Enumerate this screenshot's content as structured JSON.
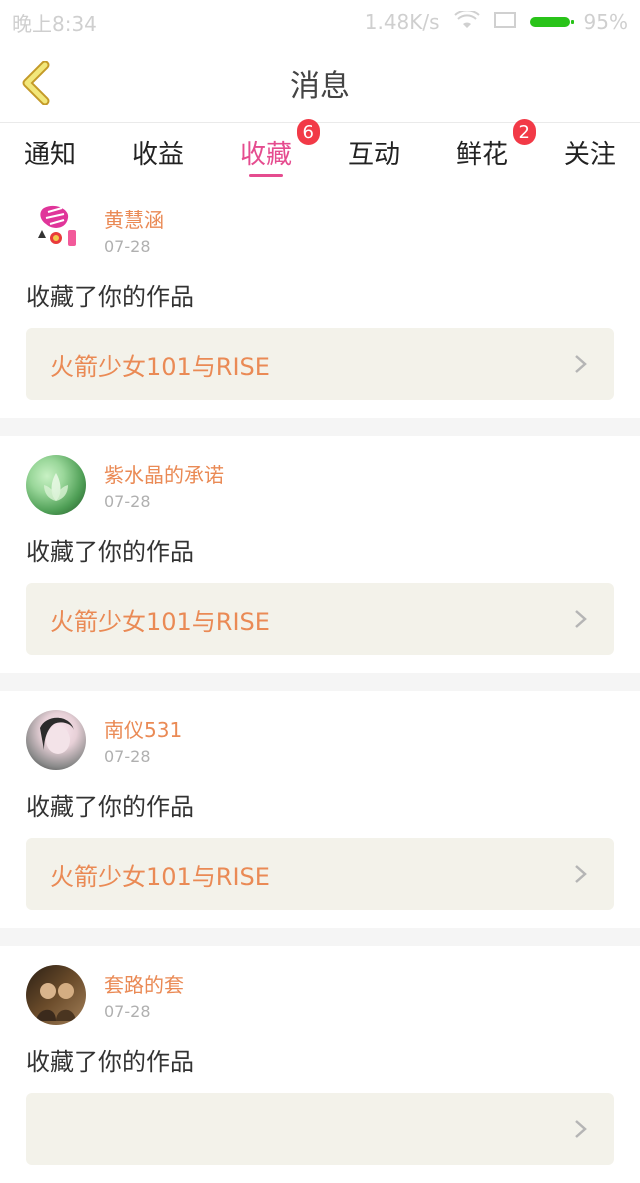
{
  "status": {
    "left": "晚上8:34",
    "speed": "1.48K/s",
    "battery_percent": "95%"
  },
  "header": {
    "title": "消息"
  },
  "tabs": [
    {
      "label": "通知",
      "badge": null
    },
    {
      "label": "收益",
      "badge": null
    },
    {
      "label": "收藏",
      "badge": "6",
      "active": true
    },
    {
      "label": "互动",
      "badge": null
    },
    {
      "label": "鲜花",
      "badge": "2"
    },
    {
      "label": "关注",
      "badge": null
    }
  ],
  "cards": [
    {
      "name": "黄慧涵",
      "date": "07-28",
      "action": "收藏了你的作品",
      "work_title": "火箭少女101与RISE"
    },
    {
      "name": "紫水晶的承诺",
      "date": "07-28",
      "action": "收藏了你的作品",
      "work_title": "火箭少女101与RISE"
    },
    {
      "name": "南仪531",
      "date": "07-28",
      "action": "收藏了你的作品",
      "work_title": "火箭少女101与RISE"
    },
    {
      "name": "套路的套",
      "date": "07-28",
      "action": "收藏了你的作品",
      "work_title": ""
    }
  ],
  "colors": {
    "accent_pink": "#e54c8f",
    "name_orange": "#ea8a55",
    "badge_red": "#f23a47"
  }
}
